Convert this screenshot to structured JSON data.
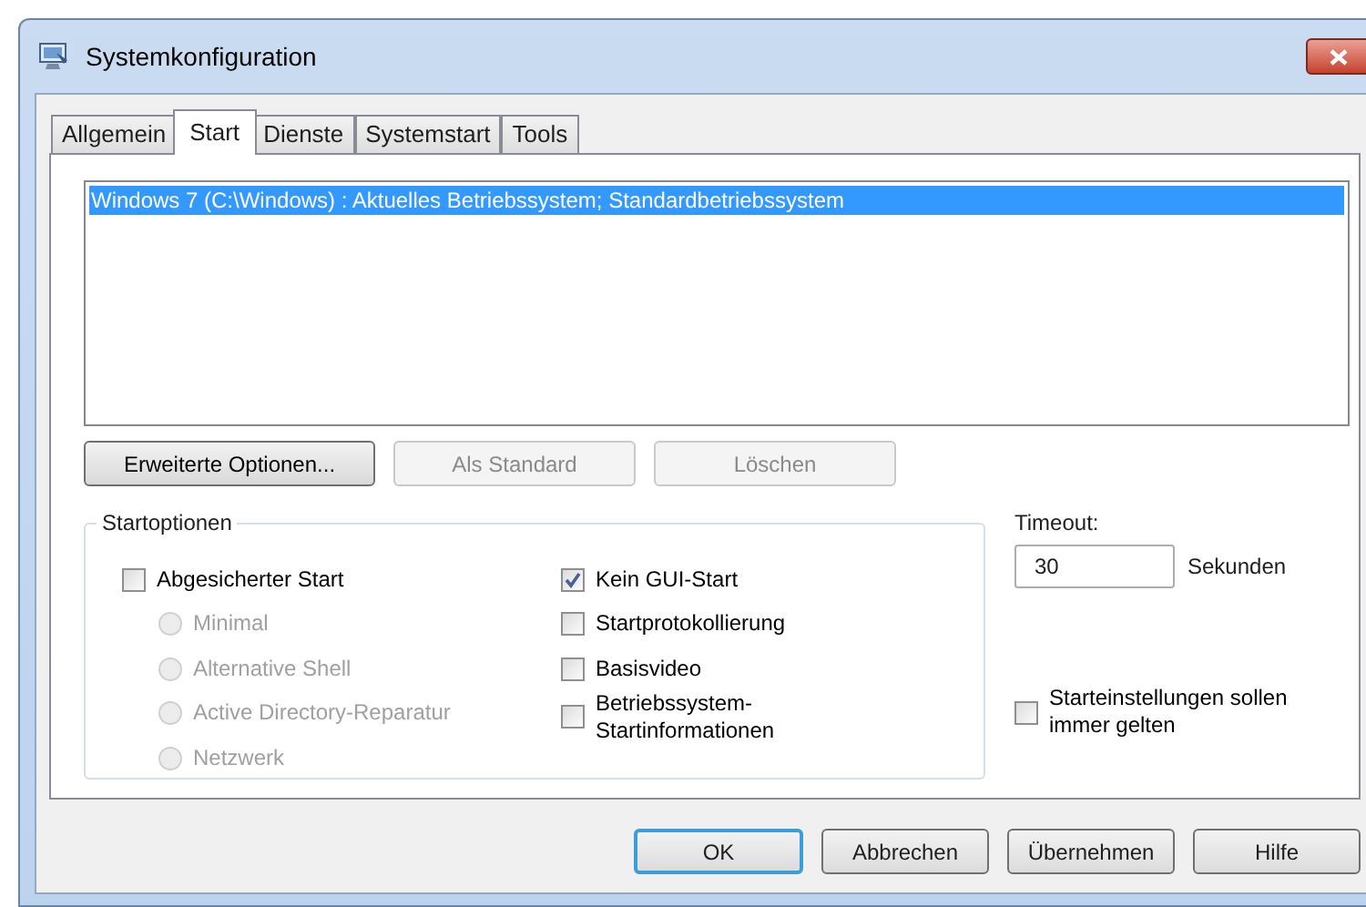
{
  "window": {
    "title": "Systemkonfiguration"
  },
  "tabs": [
    {
      "label": "Allgemein",
      "selected": false
    },
    {
      "label": "Start",
      "selected": true
    },
    {
      "label": "Dienste",
      "selected": false
    },
    {
      "label": "Systemstart",
      "selected": false
    },
    {
      "label": "Tools",
      "selected": false
    }
  ],
  "boot_list": {
    "items": [
      {
        "text": "Windows 7 (C:\\Windows) : Aktuelles Betriebssystem; Standardbetriebssystem",
        "selected": true
      }
    ]
  },
  "list_buttons": [
    {
      "label": "Erweiterte Optionen...",
      "disabled": false
    },
    {
      "label": "Als Standard",
      "disabled": true
    },
    {
      "label": "Löschen",
      "disabled": true
    }
  ],
  "startoptionen": {
    "title": "Startoptionen",
    "left": [
      {
        "kind": "checkbox",
        "label": "Abgesicherter Start",
        "checked": false,
        "disabled": false
      },
      {
        "kind": "radio",
        "label": "Minimal",
        "selected": false,
        "disabled": true
      },
      {
        "kind": "radio",
        "label": "Alternative Shell",
        "selected": false,
        "disabled": true
      },
      {
        "kind": "radio",
        "label": "Active Directory-Reparatur",
        "selected": false,
        "disabled": true
      },
      {
        "kind": "radio",
        "label": "Netzwerk",
        "selected": false,
        "disabled": true
      }
    ],
    "right": [
      {
        "kind": "checkbox",
        "label": "Kein GUI-Start",
        "checked": true,
        "disabled": false
      },
      {
        "kind": "checkbox",
        "label": "Startprotokollierung",
        "checked": false,
        "disabled": false
      },
      {
        "kind": "checkbox",
        "label": "Basisvideo",
        "checked": false,
        "disabled": false
      },
      {
        "kind": "checkbox",
        "label": "Betriebssystem-\nStartinformationen",
        "checked": false,
        "disabled": false
      }
    ]
  },
  "timeout": {
    "label": "Timeout:",
    "value": "30",
    "unit": "Sekunden"
  },
  "persist": {
    "label": "Starteinstellungen sollen\nimmer gelten",
    "checked": false
  },
  "dialog_buttons": [
    {
      "label": "OK",
      "default": true
    },
    {
      "label": "Abbrechen",
      "default": false
    },
    {
      "label": "Übernehmen",
      "default": false
    },
    {
      "label": "Hilfe",
      "default": false
    }
  ]
}
